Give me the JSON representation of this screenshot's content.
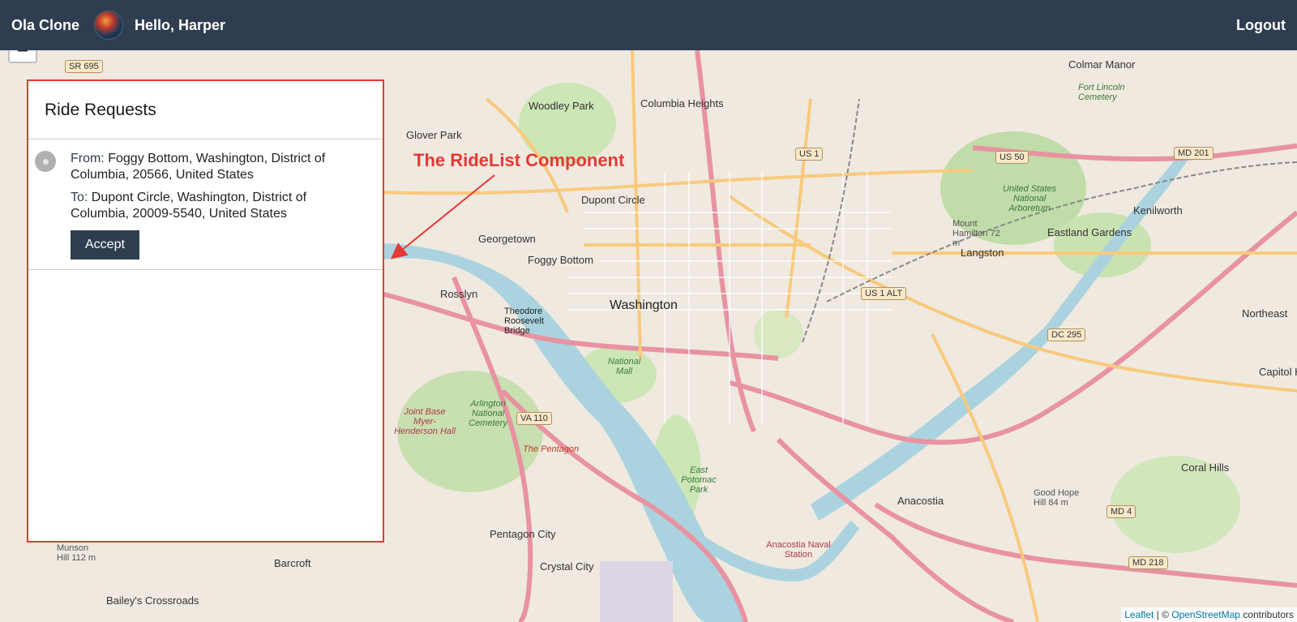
{
  "navbar": {
    "brand": "Ola Clone",
    "greeting": "Hello, Harper",
    "logout_label": "Logout"
  },
  "map": {
    "zoom_out_label": "−",
    "labels": [
      {
        "text": "Colmar Manor"
      },
      {
        "text": "Woodley Park"
      },
      {
        "text": "Columbia Heights"
      },
      {
        "text": "Glover Park"
      },
      {
        "text": "Dupont Circle"
      },
      {
        "text": "Georgetown"
      },
      {
        "text": "Foggy Bottom"
      },
      {
        "text": "Rosslyn"
      },
      {
        "text": "Washington"
      },
      {
        "text": "Langston"
      },
      {
        "text": "Eastland Gardens"
      },
      {
        "text": "Kenilworth"
      },
      {
        "text": "Northeast"
      },
      {
        "text": "Capitol H"
      },
      {
        "text": "Anacostia"
      },
      {
        "text": "Coral Hills"
      },
      {
        "text": "Pentagon City"
      },
      {
        "text": "Crystal City"
      },
      {
        "text": "Barcroft"
      },
      {
        "text": "Bailey's Crossroads"
      },
      {
        "text": "The Pentagon"
      },
      {
        "text": "Arlington National Cemetery"
      },
      {
        "text": "National Mall"
      },
      {
        "text": "East Potomac Park"
      },
      {
        "text": "Anacostia Naval Station"
      },
      {
        "text": "Theodore Roosevelt Bridge"
      },
      {
        "text": "Joint Base Myer-Henderson Hall"
      },
      {
        "text": "Fort Lincoln Cemetery"
      },
      {
        "text": "United States National Arboretum"
      },
      {
        "text": "Mount Hamilton 72 m"
      },
      {
        "text": "Good Hope Hill 84 m"
      },
      {
        "text": "Munson Hill 112 m"
      }
    ],
    "shields": [
      "SR 695",
      "US 1",
      "US 50",
      "MD 201",
      "US 1 ALT",
      "DC 295",
      "VA 110",
      "MD 4",
      "MD 218"
    ],
    "attribution": {
      "leaflet": "Leaflet",
      "separator": " | © ",
      "osm": "OpenStreetMap",
      "suffix": " contributors"
    }
  },
  "panel": {
    "title": "Ride Requests",
    "rides": [
      {
        "from_label": "From:",
        "from": "Foggy Bottom, Washington, District of Columbia, 20566, United States",
        "to_label": "To:",
        "to": "Dupont Circle, Washington, District of Columbia, 20009-5540, United States",
        "accept_label": "Accept"
      }
    ]
  },
  "annotation": {
    "text": "The RideList Component",
    "color": "#e53935"
  },
  "colors": {
    "navbar": "#2e3d50",
    "accent": "#2e3d50",
    "highlight_border": "#e53935"
  }
}
